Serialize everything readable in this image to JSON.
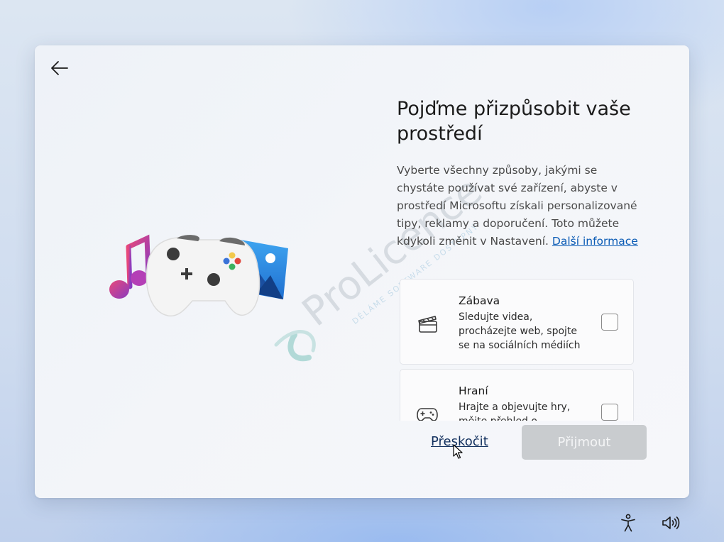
{
  "header": {
    "back_icon": "arrow-left-icon"
  },
  "main": {
    "title": "Pojďme přizpůsobit vaše prostředí",
    "description": "Vyberte všechny způsoby, jakými se chystáte používat své zařízení, abyste v prostředí Microsoftu získali personalizované tipy, reklamy a doporučení. Toto můžete kdykoli změnit v Nastavení.",
    "more_info_link": "Další informace"
  },
  "watermark": {
    "brand": "ProLicence",
    "tagline": "DĚLÁME SOFTWARE DOSTUPNÝ"
  },
  "options": [
    {
      "name": "Zábava",
      "description": "Sledujte videa, procházejte web, spojte se na sociálních médiích",
      "icon": "clapperboard-icon",
      "checked": false
    },
    {
      "name": "Hraní",
      "description": "Hrajte a objevujte hry, mějte přehled o",
      "icon": "gamepad-icon",
      "checked": false
    }
  ],
  "footer": {
    "skip_label": "Přeskočit",
    "accept_label": "Přijmout"
  },
  "taskbar": {
    "accessibility_icon": "accessibility-icon",
    "volume_icon": "volume-icon"
  },
  "colors": {
    "link": "#0a5bb5",
    "accept_disabled_bg": "#c9cccf",
    "skip_text": "#12305e"
  }
}
